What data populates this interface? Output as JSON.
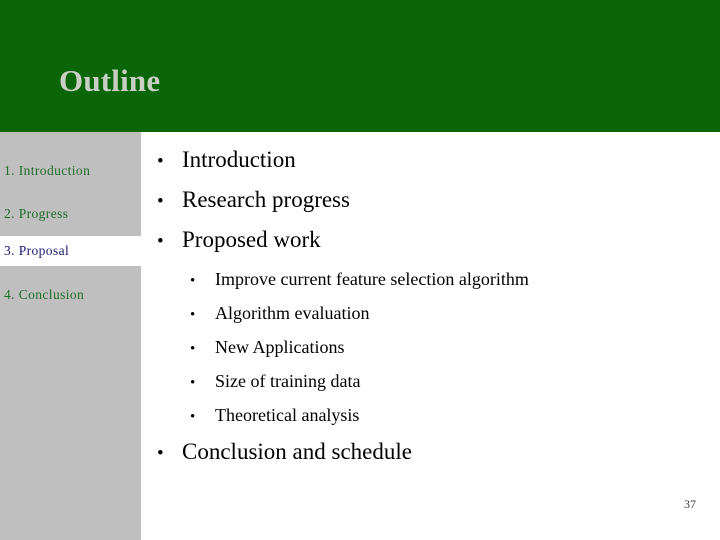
{
  "slide": {
    "title": "Outline",
    "page_number": "37",
    "colors": {
      "header_green": "#0a6608",
      "title_silver": "#c9cfc4",
      "sidebar_gray": "#bfbfbf",
      "sidebar_item_green": "#1f6b2b",
      "sidebar_active_navy": "#191970",
      "sidebar_active_band": "#ffffff",
      "body_text": "#000000",
      "background": "#ffffff"
    }
  },
  "sidebar": {
    "items": [
      {
        "label": "1. Introduction",
        "active": false
      },
      {
        "label": "2. Progress",
        "active": false
      },
      {
        "label": "3. Proposal",
        "active": true
      },
      {
        "label": "4. Conclusion",
        "active": false
      }
    ]
  },
  "content": {
    "bullet_glyph": "•",
    "level1": [
      {
        "text": "Introduction"
      },
      {
        "text": "Research progress"
      },
      {
        "text": "Proposed work"
      },
      {
        "text": "Conclusion and schedule"
      }
    ],
    "level2": [
      {
        "text": "Improve current feature selection algorithm"
      },
      {
        "text": "Algorithm evaluation"
      },
      {
        "text": "New Applications"
      },
      {
        "text": "Size of training data"
      },
      {
        "text": "Theoretical analysis"
      }
    ]
  }
}
